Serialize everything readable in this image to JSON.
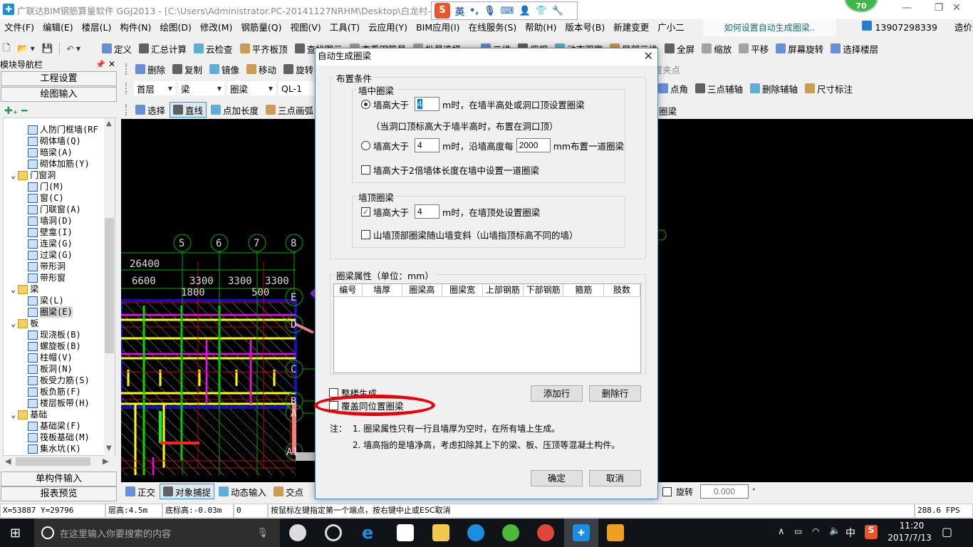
{
  "titlebar": {
    "app_icon": "glodon-icon",
    "title": "广联达BIM钢筋算量软件 GGJ2013 - [C:\\Users\\Administrator.PC-20141127NRHM\\Desktop\\白龙村-2016-08-",
    "ime": {
      "logo": "S",
      "mode": "英",
      "icons": [
        "punctuation-icon",
        "microphone-icon",
        "keyboard-icon",
        "user-icon",
        "shirt-icon",
        "wrench-icon"
      ]
    },
    "widget_value": "70",
    "controls": [
      "minimize",
      "restore",
      "close"
    ]
  },
  "menu": {
    "items": [
      "文件(F)",
      "编辑(E)",
      "楼层(L)",
      "构件(N)",
      "绘图(D)",
      "修改(M)",
      "钢筋量(Q)",
      "视图(V)",
      "工具(T)",
      "云应用(Y)",
      "BIM应用(I)",
      "在线服务(S)",
      "帮助(H)",
      "版本号(B)",
      "新建变更",
      "广小二"
    ],
    "help_link": "如何设置自动生成圈梁..",
    "account": "13907298339",
    "beans": "造价豆:0"
  },
  "toolbar1": {
    "left": [
      "定义",
      "汇总计算",
      "云检查",
      "平齐板顶",
      "查找图元",
      "查看钢筋量",
      "批量选择"
    ],
    "right": [
      "二维",
      "俯视",
      "动态观察",
      "局部三维",
      "全屏",
      "缩放",
      "平移",
      "屏幕旋转",
      "选择楼层"
    ]
  },
  "toolbar2": {
    "items": [
      "删除",
      "复制",
      "镜像",
      "移动",
      "旋转"
    ],
    "right": "设置夹点"
  },
  "toolbar3": {
    "floor": "首层",
    "type": "梁",
    "subtype": "圈梁",
    "name": "QL-1",
    "right": [
      "点角",
      "三点辅轴",
      "删除辅轴",
      "尺寸标注"
    ]
  },
  "toolbar4": {
    "items": [
      "选择",
      "直线",
      "点加长度",
      "三点画弧"
    ],
    "right": "智能布置 圈梁"
  },
  "nav": {
    "title": "模块导航栏",
    "project_settings": "工程设置",
    "drawing_input": "绘图输入",
    "single_input": "单构件输入",
    "report_preview": "报表预览",
    "tree": [
      {
        "label": "人防门框墙(RF",
        "level": 2
      },
      {
        "label": "砌体墙(Q)",
        "level": 2
      },
      {
        "label": "暗梁(A)",
        "level": 2
      },
      {
        "label": "砌体加筋(Y)",
        "level": 2
      },
      {
        "label": "门窗洞",
        "level": 1,
        "folder": true
      },
      {
        "label": "门(M)",
        "level": 2
      },
      {
        "label": "窗(C)",
        "level": 2
      },
      {
        "label": "门联窗(A)",
        "level": 2
      },
      {
        "label": "墙洞(D)",
        "level": 2
      },
      {
        "label": "壁龛(I)",
        "level": 2
      },
      {
        "label": "连梁(G)",
        "level": 2
      },
      {
        "label": "过梁(G)",
        "level": 2
      },
      {
        "label": "带形洞",
        "level": 2
      },
      {
        "label": "带形窗",
        "level": 2
      },
      {
        "label": "梁",
        "level": 1,
        "folder": true
      },
      {
        "label": "梁(L)",
        "level": 2
      },
      {
        "label": "圈梁(E)",
        "level": 2,
        "selected": true
      },
      {
        "label": "板",
        "level": 1,
        "folder": true
      },
      {
        "label": "现浇板(B)",
        "level": 2
      },
      {
        "label": "螺旋板(B)",
        "level": 2
      },
      {
        "label": "柱帽(V)",
        "level": 2
      },
      {
        "label": "板洞(N)",
        "level": 2
      },
      {
        "label": "板受力筋(S)",
        "level": 2
      },
      {
        "label": "板负筋(F)",
        "level": 2
      },
      {
        "label": "楼层板带(H)",
        "level": 2
      },
      {
        "label": "基础",
        "level": 1,
        "folder": true
      },
      {
        "label": "基础梁(F)",
        "level": 2
      },
      {
        "label": "筏板基础(M)",
        "level": 2
      },
      {
        "label": "集水坑(K)",
        "level": 2
      }
    ]
  },
  "canvas": {
    "axes_top": [
      "5",
      "6",
      "7",
      "8"
    ],
    "dims": [
      "26400",
      "6600",
      "3300",
      "3300",
      "3300",
      "1800",
      "500"
    ],
    "axes_right": [
      "E",
      "D",
      "C",
      "B",
      "A",
      "A1"
    ]
  },
  "bottom_toolbar": {
    "items": [
      "正交",
      "对象捕捉",
      "动态输入",
      "交点"
    ],
    "rotate_label": "旋转",
    "rotate_value": "0.000",
    "degree": "°"
  },
  "status": {
    "coords": "X=53887 Y=29796",
    "floor_height": "层高:4.5m",
    "base_elev": "底标高:-0.03m",
    "zero": "0",
    "hint": "按鼠标左键指定第一个端点，按右键中止或ESC取消",
    "fps": "288.6 FPS"
  },
  "taskbar": {
    "search_placeholder": "在这里输入你要搜索的内容",
    "ime": "中",
    "time": "11:20",
    "date": "2017/7/13"
  },
  "dialog": {
    "title": "自动生成圈梁",
    "group_layout": "布置条件",
    "group_mid": "墙中圈梁",
    "opt1_label": "墙高大于",
    "opt1_value": "4",
    "opt1_suffix": "m时，在墙半高处或洞口顶设置圈梁",
    "opt1_selected": true,
    "opt1_note": "（当洞口顶标高大于墙半高时，布置在洞口顶）",
    "opt2_label": "墙高大于",
    "opt2_value": "4",
    "opt2_mid": "m时，沿墙高度每",
    "opt2_spacing": "2000",
    "opt2_suffix": "mm布置一道圈梁",
    "chk_double": "墙高大于2倍墙体长度在墙中设置一道圈梁",
    "chk_double_checked": false,
    "group_top": "墙顶圈梁",
    "top_label": "墙高大于",
    "top_value": "4",
    "top_suffix": "m时，在墙顶处设置圈梁",
    "top_checked": true,
    "chk_gable": "山墙顶部圈梁随山墙变斜（山墙指顶标高不同的墙）",
    "chk_gable_checked": false,
    "group_props": "圈梁属性（单位：mm）",
    "columns": [
      "编号",
      "墙厚",
      "圈梁高",
      "圈梁宽",
      "上部钢筋",
      "下部钢筋",
      "箍筋",
      "肢数"
    ],
    "rows": [],
    "chk_whole": "整楼生成",
    "chk_whole_checked": false,
    "chk_cover": "覆盖同位置圈梁",
    "chk_cover_checked": false,
    "add_row": "添加行",
    "delete_row": "删除行",
    "note_prefix": "注：",
    "note1": "1. 圈梁属性只有一行且墙厚为空时，在所有墙上生成。",
    "note2": "2. 墙高指的是墙净高，考虑扣除其上下的梁、板、压顶等混凝土构件。",
    "ok": "确定",
    "cancel": "取消",
    "annotation_color": "#e8000a"
  }
}
